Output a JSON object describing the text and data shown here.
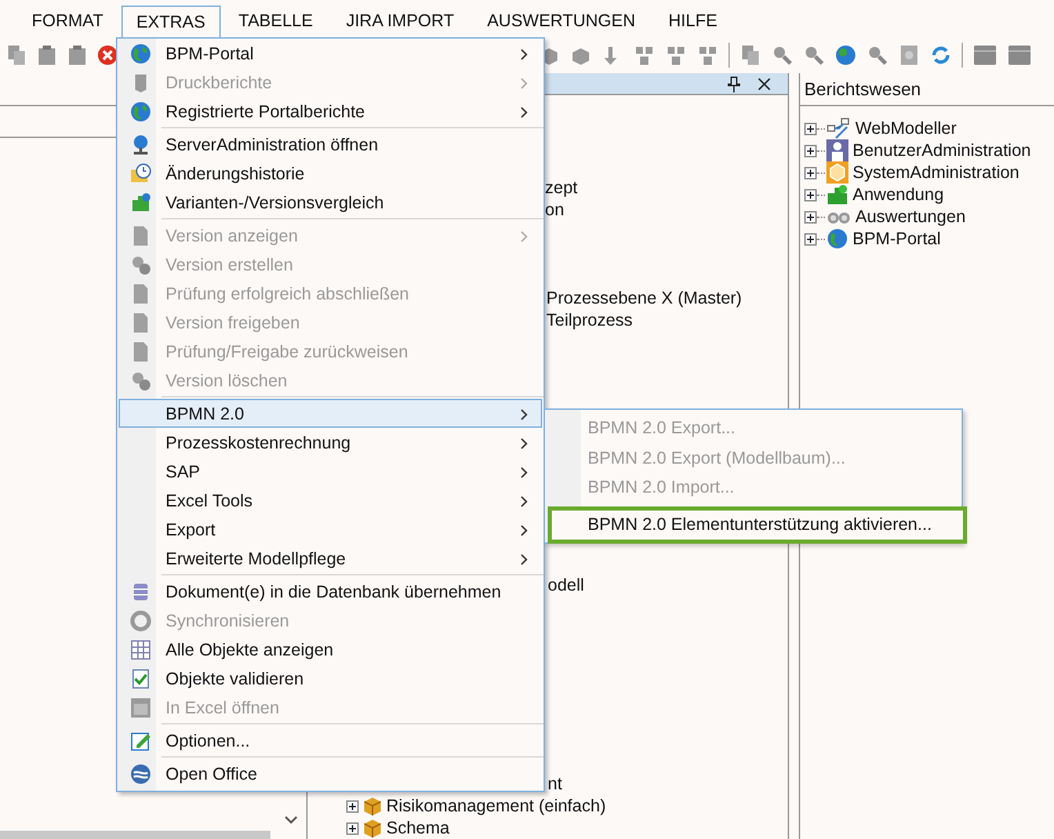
{
  "menubar": [
    {
      "label": "FORMAT",
      "selected": false
    },
    {
      "label": "EXTRAS",
      "selected": true
    },
    {
      "label": "TABELLE",
      "selected": false
    },
    {
      "label": "JIRA IMPORT",
      "selected": false
    },
    {
      "label": "AUSWERTUNGEN",
      "selected": false
    },
    {
      "label": "HILFE",
      "selected": false
    }
  ],
  "extras_menu": {
    "sections": [
      [
        {
          "label": "BPM-Portal",
          "disabled": false,
          "submenu": true,
          "selected": false
        },
        {
          "label": "Druckberichte",
          "disabled": true,
          "submenu": true,
          "selected": false
        },
        {
          "label": "Registrierte Portalberichte",
          "disabled": false,
          "submenu": true,
          "selected": false
        }
      ],
      [
        {
          "label": "ServerAdministration öffnen",
          "disabled": false,
          "submenu": false,
          "selected": false
        },
        {
          "label": "Änderungshistorie",
          "disabled": false,
          "submenu": false,
          "selected": false
        },
        {
          "label": "Varianten-/Versionsvergleich",
          "disabled": false,
          "submenu": false,
          "selected": false
        }
      ],
      [
        {
          "label": "Version anzeigen",
          "disabled": true,
          "submenu": true,
          "selected": false
        },
        {
          "label": "Version erstellen",
          "disabled": true,
          "submenu": false,
          "selected": false
        },
        {
          "label": "Prüfung erfolgreich abschließen",
          "disabled": true,
          "submenu": false,
          "selected": false
        },
        {
          "label": "Version freigeben",
          "disabled": true,
          "submenu": false,
          "selected": false
        },
        {
          "label": "Prüfung/Freigabe zurückweisen",
          "disabled": true,
          "submenu": false,
          "selected": false
        },
        {
          "label": "Version löschen",
          "disabled": true,
          "submenu": false,
          "selected": false
        }
      ],
      [
        {
          "label": "BPMN 2.0",
          "disabled": false,
          "submenu": true,
          "selected": true
        },
        {
          "label": "Prozesskostenrechnung",
          "disabled": false,
          "submenu": true,
          "selected": false
        },
        {
          "label": "SAP",
          "disabled": false,
          "submenu": true,
          "selected": false
        },
        {
          "label": "Excel Tools",
          "disabled": false,
          "submenu": true,
          "selected": false
        },
        {
          "label": "Export",
          "disabled": false,
          "submenu": true,
          "selected": false
        },
        {
          "label": "Erweiterte Modellpflege",
          "disabled": false,
          "submenu": true,
          "selected": false
        }
      ],
      [
        {
          "label": "Dokument(e) in die Datenbank übernehmen",
          "disabled": false,
          "submenu": false,
          "selected": false
        },
        {
          "label": "Synchronisieren",
          "disabled": true,
          "submenu": false,
          "selected": false
        },
        {
          "label": "Alle Objekte anzeigen",
          "disabled": false,
          "submenu": false,
          "selected": false
        },
        {
          "label": "Objekte validieren",
          "disabled": false,
          "submenu": false,
          "selected": false
        },
        {
          "label": "In Excel öffnen",
          "disabled": true,
          "submenu": false,
          "selected": false
        }
      ],
      [
        {
          "label": "Optionen...",
          "disabled": false,
          "submenu": false,
          "selected": false
        }
      ],
      [
        {
          "label": "Open Office",
          "disabled": false,
          "submenu": false,
          "selected": false
        }
      ]
    ]
  },
  "bpmn_submenu": [
    {
      "label": "BPMN 2.0 Export...",
      "disabled": true,
      "highlighted": false
    },
    {
      "label": "BPMN 2.0 Export (Modellbaum)...",
      "disabled": true,
      "highlighted": false
    },
    {
      "label": "BPMN 2.0 Import...",
      "disabled": true,
      "highlighted": false
    },
    {
      "label": "BPMN 2.0 Elementunterstützung aktivieren...",
      "disabled": false,
      "highlighted": true
    }
  ],
  "center_tree": [
    {
      "label": "zept",
      "kind": "fragment"
    },
    {
      "label": "on",
      "kind": "fragment"
    },
    {
      "label": "Prozessebene X (Master)",
      "kind": "fragment"
    },
    {
      "label": "Teilprozess",
      "kind": "fragment"
    },
    {
      "label": "odell",
      "kind": "fragment"
    },
    {
      "label": "nt",
      "kind": "fragment"
    },
    {
      "label": "Risikomanagement (einfach)",
      "kind": "node",
      "expanded": false
    },
    {
      "label": "Schema",
      "kind": "node",
      "expanded": false
    }
  ],
  "right_panel": {
    "title": "Berichtswesen",
    "items": [
      {
        "label": "WebModeller",
        "expanded": false
      },
      {
        "label": "BenutzerAdministration",
        "expanded": false
      },
      {
        "label": "SystemAdministration",
        "expanded": false
      },
      {
        "label": "Anwendung",
        "expanded": false
      },
      {
        "label": "Auswertungen",
        "expanded": false
      },
      {
        "label": "BPM-Portal",
        "expanded": false
      }
    ]
  }
}
